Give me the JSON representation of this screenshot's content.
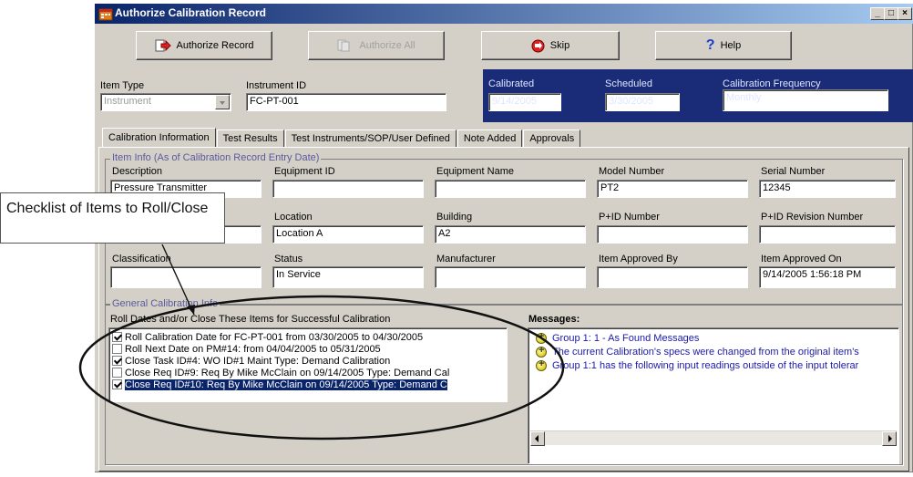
{
  "window": {
    "title": "Authorize Calibration Record",
    "minimize": "_",
    "maximize": "□",
    "close": "×"
  },
  "toolbar": {
    "authorize_record": "Authorize Record",
    "authorize_all": "Authorize All",
    "skip": "Skip",
    "help": "Help"
  },
  "header": {
    "item_type_label": "Item Type",
    "item_type_value": "Instrument",
    "instrument_id_label": "Instrument ID",
    "instrument_id_value": "FC-PT-001",
    "calibrated_label": "Calibrated",
    "calibrated_value": "9/14/2005",
    "scheduled_label": "Scheduled",
    "scheduled_value": "3/30/2005",
    "frequency_label": "Calibration Frequency",
    "frequency_value": "Monthly"
  },
  "tabs": [
    "Calibration Information",
    "Test Results",
    "Test Instruments/SOP/User Defined",
    "Note Added",
    "Approvals"
  ],
  "item_info": {
    "group_title": "Item Info (As of Calibration Record Entry Date)",
    "fields": [
      {
        "label": "Description",
        "value": "Pressure Transmitter"
      },
      {
        "label": "Equipment ID",
        "value": ""
      },
      {
        "label": "Equipment Name",
        "value": ""
      },
      {
        "label": "Model Number",
        "value": "PT2"
      },
      {
        "label": "Serial Number",
        "value": "12345"
      },
      {
        "label": "",
        "value": ""
      },
      {
        "label": "Location",
        "value": "Location A"
      },
      {
        "label": "Building",
        "value": "A2"
      },
      {
        "label": "P+ID Number",
        "value": ""
      },
      {
        "label": "P+ID Revision Number",
        "value": ""
      },
      {
        "label": "Classification",
        "value": ""
      },
      {
        "label": "Status",
        "value": "In Service"
      },
      {
        "label": "Manufacturer",
        "value": ""
      },
      {
        "label": "Item Approved By",
        "value": ""
      },
      {
        "label": "Item Approved On",
        "value": "9/14/2005 1:56:18 PM"
      }
    ]
  },
  "general": {
    "group_title": "General Calibration Info",
    "roll_label": "Roll Dates and/or Close These Items for Successful Calibration",
    "checklist": [
      {
        "checked": true,
        "selected": false,
        "text": "Roll Calibration Date for FC-PT-001 from 03/30/2005 to 04/30/2005"
      },
      {
        "checked": false,
        "selected": false,
        "text": "Roll Next Date on PM#14: from 04/04/2005 to 05/31/2005"
      },
      {
        "checked": true,
        "selected": false,
        "text": "Close Task ID#4: WO ID#1 Maint Type: Demand Calibration"
      },
      {
        "checked": false,
        "selected": false,
        "text": "Close Req ID#9: Req By Mike McClain on 09/14/2005 Type: Demand Cal"
      },
      {
        "checked": true,
        "selected": true,
        "text": "Close Req ID#10: Req By Mike McClain on 09/14/2005 Type: Demand C"
      }
    ],
    "messages_label": "Messages:",
    "messages": [
      "Group 1: 1 - As Found Messages",
      "The current Calibration's specs were changed from the original item's",
      "Group 1:1 has the following input readings outside of the input tolerar"
    ]
  },
  "callout": {
    "text": "Checklist of Items to Roll/Close"
  },
  "colors": {
    "title_start": "#0a246a",
    "header_band": "#1a2b78",
    "selection": "#0a246a",
    "message_text": "#1a1aa8"
  },
  "icons": [
    "calendar-app-icon",
    "authorize-arrow-icon",
    "authorize-all-icon",
    "skip-icon",
    "help-question-icon"
  ]
}
